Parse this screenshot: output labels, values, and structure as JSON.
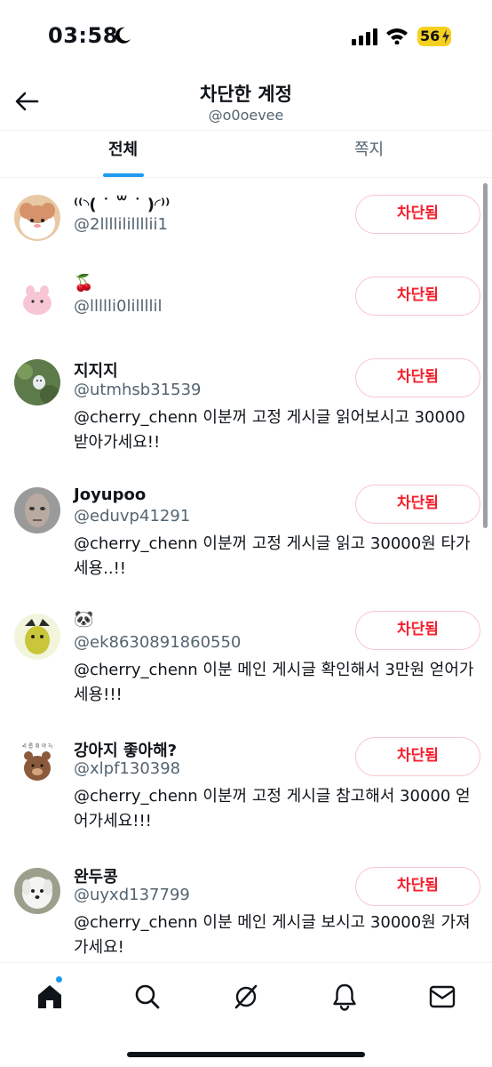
{
  "status_bar": {
    "time": "03:58",
    "battery": "56"
  },
  "header": {
    "title": "차단한 계정",
    "subtitle": "@o0oevee"
  },
  "tabs": [
    {
      "label": "전체",
      "selected": true
    },
    {
      "label": "쪽지",
      "selected": false
    }
  ],
  "accounts": [
    {
      "name": "⁽⁽◝( ˙ ꒳ ˙ )◜⁾⁾",
      "handle": "@2llllilillllii1",
      "bio": "",
      "button": "차단됨"
    },
    {
      "name": "🍒",
      "handle": "@llllli0lillllil",
      "bio": "",
      "button": "차단됨"
    },
    {
      "name": "지지지",
      "handle": "@utmhsb31539",
      "bio": "@cherry_chenn 이분꺼 고정 게시글 읽어보시고 30000 받아가세요!!",
      "button": "차단됨"
    },
    {
      "name": "Joyupoo",
      "handle": "@eduvp41291",
      "bio": "@cherry_chenn 이분꺼 고정 게시글 읽고 30000원 타가세용..!!",
      "button": "차단됨"
    },
    {
      "name": "🐼",
      "handle": "@ek8630891860550",
      "bio": "@cherry_chenn 이분 메인 게시글 확인해서 3만원 얻어가세용!!!",
      "button": "차단됨"
    },
    {
      "name": "강아지 좋아해?",
      "handle": "@xlpf130398",
      "bio": "@cherry_chenn 이분꺼 고정 게시글 참고해서 30000 얻어가세요!!!",
      "button": "차단됨"
    },
    {
      "name": "완두콩",
      "handle": "@uyxd137799",
      "bio": "@cherry_chenn 이분 메인 게시글 보시고 30000원 가져가세요!",
      "button": "차단됨"
    }
  ],
  "avatar_text": {
    "dog_caption": "외 롭 쥐 야 하"
  },
  "colors": {
    "accent": "#1d9bf0",
    "blocked_red": "#f4212e",
    "blocked_border": "#f8c6cc",
    "secondary_text": "#536471"
  },
  "nav": [
    {
      "icon": "home-icon",
      "active": true,
      "notification_dot": true
    },
    {
      "icon": "search-icon",
      "active": false
    },
    {
      "icon": "grok-icon",
      "active": false
    },
    {
      "icon": "bell-icon",
      "active": false
    },
    {
      "icon": "mail-icon",
      "active": false
    }
  ]
}
